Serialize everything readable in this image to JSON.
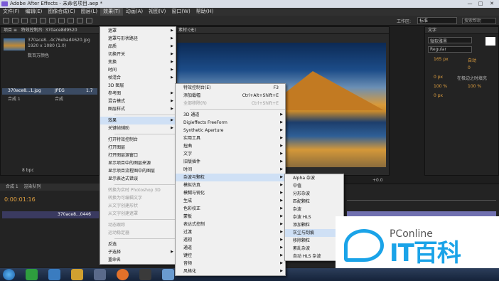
{
  "window": {
    "title": "Adobe After Effects - 未命名项目.aep *",
    "controls": [
      "—",
      "□",
      "✕"
    ]
  },
  "menubar": [
    "文件(F)",
    "编辑(E)",
    "图像合成(C)",
    "图层(L)",
    "效果(T)",
    "动画(A)",
    "视图(V)",
    "窗口(W)",
    "帮助(H)"
  ],
  "toolbar": {
    "workspace_label": "工作区:",
    "workspace_value": "标准",
    "search_placeholder": "搜索帮助"
  },
  "project": {
    "tabs": [
      "项目 ≡",
      "特效控制台: 370ace8d9520"
    ],
    "file_name": "370ace8...4c76ebad4620.jpg",
    "file_info": "1920 x 1080 (1.0)",
    "file_desc": "数百万颜色",
    "items": [
      {
        "name": "370ace8...1.jpg",
        "type": "JPEG",
        "size": "1.7"
      },
      {
        "name": "合成 1",
        "type": "合成",
        "size": ""
      }
    ],
    "bpc": "8 bpc"
  },
  "composition": {
    "tab": "素材:(无)"
  },
  "right_panel": {
    "title": "文字",
    "font": "微软雅黑",
    "style": "Regular",
    "size1": "165 px",
    "size2": "自动",
    "tracking": "0",
    "scale1": "100 %",
    "scale2": "100 %",
    "baseline": "0 px",
    "indent": "0 px",
    "auto": "在极边之时填充"
  },
  "timeline": {
    "tabs": [
      "合成 1",
      "渲染队列"
    ],
    "timecode": "0:00:01:16",
    "layer": "370ace8...0446",
    "value": "+0.0"
  },
  "menu1": {
    "items": [
      {
        "label": "遮罩",
        "arrow": true
      },
      {
        "label": "遮罩与形状路径",
        "arrow": true
      },
      {
        "label": "品质",
        "arrow": true
      },
      {
        "label": "切换开关",
        "arrow": true
      },
      {
        "label": "变换",
        "arrow": true
      },
      {
        "label": "时间",
        "arrow": true
      },
      {
        "label": "帧混合",
        "arrow": true
      },
      {
        "label": "3D 图层",
        "arrow": false
      },
      {
        "label": "参考图",
        "arrow": true
      },
      {
        "label": "混合模式",
        "arrow": true
      },
      {
        "label": "图层样式",
        "arrow": true
      },
      {
        "sep": true
      },
      {
        "label": "效果",
        "arrow": true,
        "hl": true
      },
      {
        "label": "关键帧辅助",
        "arrow": true
      },
      {
        "sep": true
      },
      {
        "label": "打开特效控制台",
        "arrow": false
      },
      {
        "label": "打开图层",
        "arrow": false
      },
      {
        "label": "打开图层源窗口",
        "arrow": false
      },
      {
        "label": "显示项目中的图层来源",
        "arrow": false
      },
      {
        "label": "显示项目流程图中的图层",
        "arrow": false
      },
      {
        "label": "显示表达式错误",
        "arrow": false
      },
      {
        "sep": true
      },
      {
        "label": "转换为实时 Photoshop 3D",
        "dis": true
      },
      {
        "label": "转换为可编辑文字",
        "dis": true
      },
      {
        "label": "从文字创建形状",
        "dis": true
      },
      {
        "label": "从文字创建遮罩",
        "dis": true
      },
      {
        "sep": true
      },
      {
        "label": "动态跟踪",
        "dis": true
      },
      {
        "label": "运动稳定器",
        "dis": true
      },
      {
        "sep": true
      },
      {
        "label": "反选",
        "arrow": false
      },
      {
        "label": "子选择",
        "arrow": true
      },
      {
        "label": "重命名",
        "arrow": false
      }
    ]
  },
  "menu2": {
    "items": [
      {
        "label": "特效控制台(E)",
        "shortcut": "F3"
      },
      {
        "label": "添加载幅",
        "shortcut": "Ctrl+Alt+Shift+E"
      },
      {
        "label": "全部移除(R)",
        "shortcut": "Ctrl+Shift+E",
        "dis": true
      },
      {
        "sep": true
      },
      {
        "label": "3D 通道",
        "arrow": true
      },
      {
        "label": "Digieffects FreeForm",
        "arrow": true
      },
      {
        "label": "Synthetic Aperture",
        "arrow": true
      },
      {
        "label": "实用工具",
        "arrow": true
      },
      {
        "label": "扭曲",
        "arrow": true
      },
      {
        "label": "文字",
        "arrow": true
      },
      {
        "label": "旧版插件",
        "arrow": true
      },
      {
        "label": "时间",
        "arrow": true
      },
      {
        "label": "杂波与颗粒",
        "arrow": true,
        "hl": true
      },
      {
        "label": "模拟仿真",
        "arrow": true
      },
      {
        "label": "模糊与锐化",
        "arrow": true
      },
      {
        "label": "生成",
        "arrow": true
      },
      {
        "label": "色彩校正",
        "arrow": true
      },
      {
        "label": "蒙板",
        "arrow": true
      },
      {
        "label": "表达式控制",
        "arrow": true
      },
      {
        "label": "过渡",
        "arrow": true
      },
      {
        "label": "透视",
        "arrow": true
      },
      {
        "label": "通道",
        "arrow": true
      },
      {
        "label": "键控",
        "arrow": true
      },
      {
        "label": "音频",
        "arrow": true
      },
      {
        "label": "风格化",
        "arrow": true
      }
    ]
  },
  "menu3": {
    "items": [
      {
        "label": "Alpha 杂波"
      },
      {
        "label": "中值"
      },
      {
        "label": "分形杂波"
      },
      {
        "label": "匹配颗粒"
      },
      {
        "label": "杂波"
      },
      {
        "label": "杂波 HLS"
      },
      {
        "label": "添加颗粒"
      },
      {
        "label": "灰尘与刮痕",
        "hl": true
      },
      {
        "label": "移除颗粒"
      },
      {
        "label": "紊乱杂波"
      },
      {
        "label": "自动 HLS 杂波"
      }
    ]
  },
  "watermark": {
    "brand": "PConline",
    "text": "IT百科"
  }
}
